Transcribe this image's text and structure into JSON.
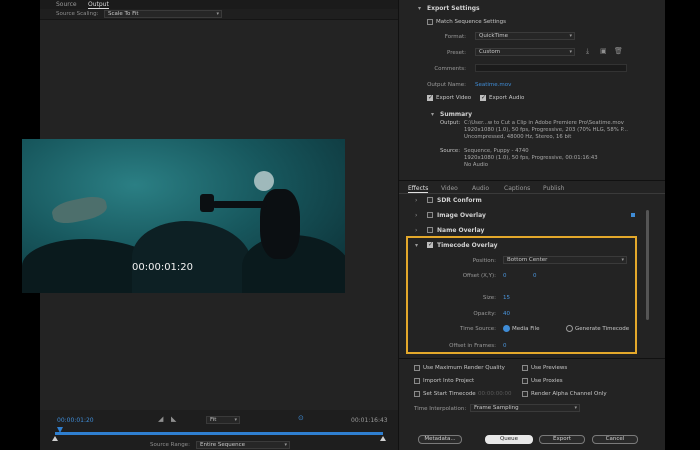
{
  "left_panel": {
    "tabs": [
      "Source",
      "Output"
    ],
    "source_scaling_label": "Source Scaling:",
    "source_scaling_value": "Scale To Fit",
    "overlay_timecode": "00:00:01:20",
    "transport": {
      "current_time": "00:00:01:20",
      "fit_value": "Fit",
      "end_time": "00:01:16:43",
      "source_range_label": "Source Range:",
      "source_range_value": "Entire Sequence"
    }
  },
  "export_settings": {
    "title": "Export Settings",
    "match_sequence_label": "Match Sequence Settings",
    "format_label": "Format:",
    "format_value": "QuickTime",
    "preset_label": "Preset:",
    "preset_value": "Custom",
    "comments_label": "Comments:",
    "output_name_label": "Output Name:",
    "output_name_value": "Seatime.mov",
    "export_video_label": "Export Video",
    "export_audio_label": "Export Audio",
    "summary_title": "Summary",
    "summary_output_label": "Output:",
    "summary_output_lines": [
      "C:\\User...w to Cut a Clip in Adobe Premiere Pro\\Seatime.mov",
      "1920x1080 (1.0), 50 fps, Progressive, 203 (70% HLG, 58% P...",
      "Uncompressed, 48000 Hz, Stereo, 16 bit"
    ],
    "summary_source_label": "Source:",
    "summary_source_lines": [
      "Sequence, Puppy - 4740",
      "1920x1080 (1.0), 50 fps, Progressive, 00:01:16:43",
      "No Audio"
    ]
  },
  "effects_tabs": [
    "Effects",
    "Video",
    "Audio",
    "Captions",
    "Publish"
  ],
  "effects": {
    "sdr_conform": "SDR Conform",
    "image_overlay": "Image Overlay",
    "name_overlay": "Name Overlay",
    "timecode_overlay": "Timecode Overlay",
    "position_label": "Position:",
    "position_value": "Bottom Center",
    "offset_label": "Offset (X,Y):",
    "offset_x": "0",
    "offset_y": "0",
    "size_label": "Size:",
    "size_value": "15",
    "opacity_label": "Opacity:",
    "opacity_value": "40",
    "time_source_label": "Time Source:",
    "media_file_label": "Media File",
    "generate_timecode_label": "Generate Timecode",
    "offset_frames_label": "Offset in Frames:",
    "offset_frames_value": "0"
  },
  "options": {
    "max_render_quality": "Use Maximum Render Quality",
    "use_previews": "Use Previews",
    "import_into_project": "Import Into Project",
    "use_proxies": "Use Proxies",
    "set_start_timecode": "Set Start Timecode",
    "start_timecode_value": "00:00:00:00",
    "render_alpha": "Render Alpha Channel Only",
    "time_interp_label": "Time Interpolation:",
    "time_interp_value": "Frame Sampling"
  },
  "buttons": {
    "metadata": "Metadata...",
    "queue": "Queue",
    "export": "Export",
    "cancel": "Cancel"
  },
  "colors": {
    "accent_blue": "#3f8cd6",
    "highlight_orange": "#e3a82b",
    "panel_bg": "#232323"
  }
}
